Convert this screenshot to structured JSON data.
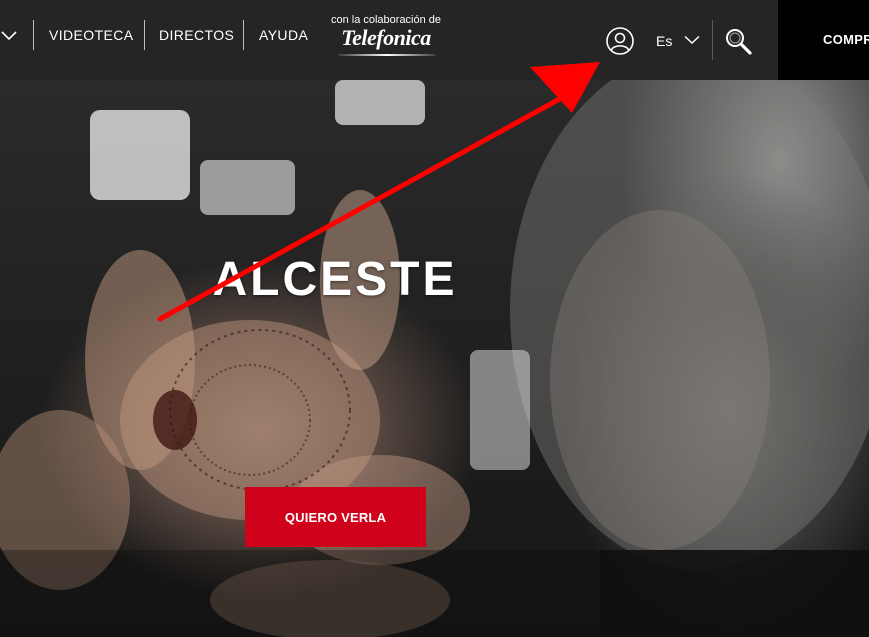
{
  "nav": {
    "items": [
      {
        "label": "VIDEOTECA"
      },
      {
        "label": "DIRECTOS"
      },
      {
        "label": "AYUDA"
      }
    ],
    "brand_caption": "con la colaboración de",
    "brand_logo_text": "Telefonica",
    "language": "Es",
    "buy_label": "COMPR"
  },
  "hero": {
    "title": "ALCESTE",
    "cta_label": "QUIERO VERLA"
  },
  "colors": {
    "topbar_bg": "#252525",
    "buy_bg": "#000000",
    "cta_bg": "#d0021b",
    "annotation_arrow": "#ff0000"
  },
  "icons": {
    "menu": "chevron-down-icon",
    "user": "user-circle-icon",
    "language": "chevron-down-icon",
    "search": "search-icon",
    "annotation": "red-arrow-annotation"
  }
}
